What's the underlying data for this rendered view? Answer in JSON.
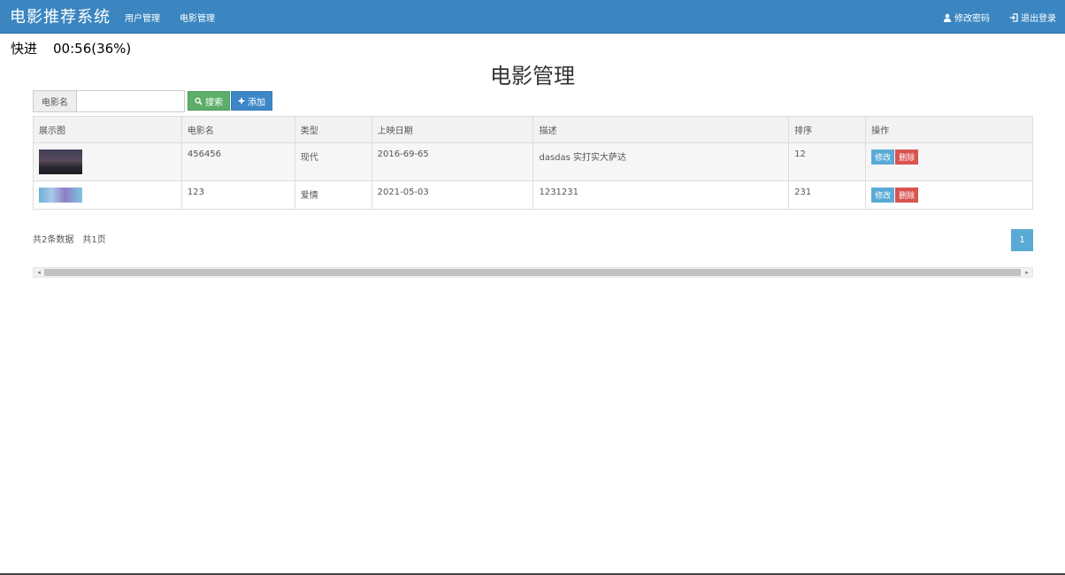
{
  "navbar": {
    "brand": "电影推荐系统",
    "links": [
      "用户管理",
      "电影管理"
    ],
    "change_password": "修改密码",
    "logout": "退出登录"
  },
  "overlay": {
    "label": "快进",
    "time": "00:56(36%)"
  },
  "page_title": "电影管理",
  "search": {
    "label": "电影名",
    "value": "",
    "search_btn": "搜索",
    "add_btn": "添加"
  },
  "table": {
    "headers": [
      "展示图",
      "电影名",
      "类型",
      "上映日期",
      "描述",
      "排序",
      "操作"
    ],
    "rows": [
      {
        "name": "456456",
        "type": "现代",
        "date": "2016-69-65",
        "desc": "dasdas 实打实大萨达",
        "order": "12"
      },
      {
        "name": "123",
        "type": "爱情",
        "date": "2021-05-03",
        "desc": "1231231",
        "order": "231"
      }
    ],
    "edit_label": "修改",
    "delete_label": "删除"
  },
  "footer": {
    "total": "共2条数据",
    "pages": "共1页",
    "current_page": "1"
  },
  "colors": {
    "navbar": "#3b86c1",
    "search_btn": "#5cae6a",
    "add_btn": "#3d87c7",
    "edit_btn": "#5aaad6",
    "delete_btn": "#d9534f"
  }
}
